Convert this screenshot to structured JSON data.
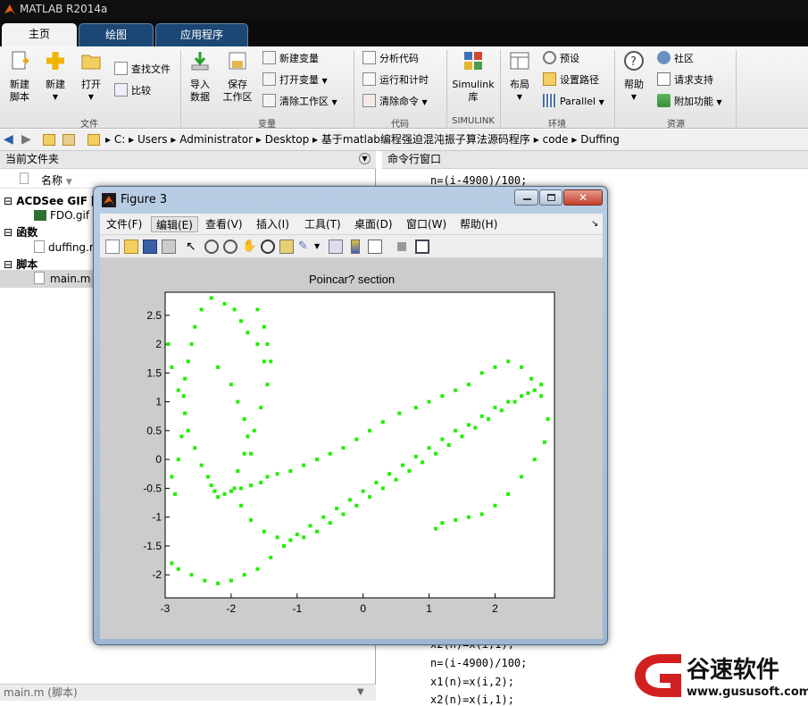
{
  "window": {
    "title": "MATLAB R2014a"
  },
  "ribbon_tabs": [
    "主页",
    "绘图",
    "应用程序"
  ],
  "ribbon": {
    "file_group": {
      "label": "文件",
      "new_script": "新建\n脚本",
      "new": "新建",
      "open": "打开",
      "find_files": "查找文件",
      "compare": "比较"
    },
    "variable_group": {
      "label": "变量",
      "import_data": "导入\n数据",
      "save_workspace": "保存\n工作区",
      "new_variable": "新建变量",
      "open_variable": "打开变量",
      "clear_workspace": "清除工作区"
    },
    "code_group": {
      "label": "代码",
      "analyze_code": "分析代码",
      "run_and_time": "运行和计时",
      "clear_commands": "清除命令"
    },
    "simulink_group": {
      "label": "SIMULINK",
      "simulink": "Simulink\n库"
    },
    "environment_group": {
      "label": "环境",
      "layout": "布局",
      "preferences": "预设",
      "set_path": "设置路径",
      "parallel": "Parallel"
    },
    "resources_group": {
      "label": "资源",
      "help": "帮助",
      "community": "社区",
      "request_support": "请求支持",
      "add_ons": "附加功能"
    }
  },
  "address_path": [
    "C:",
    "Users",
    "Administrator",
    "Desktop",
    "基于matlab编程强迫混沌振子算法源码程序",
    "code",
    "Duffing"
  ],
  "current_folder": {
    "title": "当前文件夹",
    "column_name": "名称",
    "sections": [
      {
        "name": "ACDSee GIF 图",
        "files": [
          "FDO.gif"
        ]
      },
      {
        "name": "函数",
        "files": [
          "duffing.m"
        ]
      },
      {
        "name": "脚本",
        "files": [
          "main.m"
        ]
      }
    ],
    "status": "main.m (脚本)"
  },
  "command_window": {
    "title": "命令行窗口",
    "lines_top": [
      "n=(i-4900)/100;"
    ],
    "lines_bottom": [
      "x2(n)=x(i,1);",
      "n=(i-4900)/100;",
      "x1(n)=x(i,2);",
      "x2(n)=x(i,1);"
    ]
  },
  "figure": {
    "title": "Figure 3",
    "menus": [
      "文件(F)",
      "编辑(E)",
      "查看(V)",
      "插入(I)",
      "工具(T)",
      "桌面(D)",
      "窗口(W)",
      "帮助(H)"
    ],
    "menu_overflow": "↘"
  },
  "chart_data": {
    "type": "scatter",
    "title": "Poincar? section",
    "xlabel": "",
    "ylabel": "",
    "xlim": [
      -3,
      2.9
    ],
    "ylim": [
      -2.4,
      2.9
    ],
    "xticks": [
      "-3",
      "-2",
      "-1",
      "0",
      "1",
      "2"
    ],
    "yticks": [
      "-2",
      "-1.5",
      "-1",
      "-0.5",
      "0",
      "0.5",
      "1",
      "1.5",
      "2",
      "2.5"
    ],
    "marker_color": "#22ee00",
    "series": [
      {
        "values_x": [
          -2.1,
          -1.95,
          -1.85,
          -1.75,
          -1.6,
          -1.5,
          -2.3,
          -2.45,
          -2.55,
          -2.6,
          -2.65,
          -2.7,
          -2.72,
          -2.7,
          -2.65,
          -2.55,
          -2.45,
          -2.35,
          -2.3,
          -2.25,
          -2.2,
          -2.1,
          -2.0,
          -1.85,
          -1.7,
          -1.55,
          -1.45,
          -1.3,
          -1.1,
          -0.9,
          -0.7,
          -0.5,
          -0.3,
          -0.1,
          0.1,
          0.3,
          0.55,
          0.8,
          1.0,
          1.2,
          1.4,
          1.6,
          1.8,
          2.0,
          2.2,
          2.4,
          2.55,
          2.7,
          2.8,
          2.75,
          2.6,
          2.4,
          2.2,
          2.0,
          1.8,
          1.6,
          1.4,
          1.2,
          1.1,
          -2.9,
          -2.8,
          -2.6,
          -2.4,
          -2.2,
          -2.0,
          -1.8,
          -1.6,
          -1.4,
          -1.2,
          -1.0,
          -0.8,
          -0.6,
          -0.4,
          -0.2,
          0.0,
          0.2,
          0.4,
          0.6,
          0.8,
          1.0,
          1.2,
          1.4,
          1.6,
          1.8,
          2.0,
          2.2,
          2.4,
          2.6,
          -2.95,
          -2.9,
          -2.8,
          -2.7,
          -2.75,
          -2.8,
          -2.9,
          -2.85,
          -2.2,
          -2.0,
          -1.9,
          -1.8,
          -1.75,
          -1.8,
          -1.9,
          -1.95,
          -1.85,
          -1.7,
          -1.5,
          -1.3,
          -1.1,
          -0.9,
          -0.7,
          -0.5,
          -0.3,
          -0.1,
          0.1,
          0.3,
          0.5,
          0.7,
          0.9,
          1.1,
          1.3,
          1.5,
          1.7,
          1.9,
          2.1,
          2.3,
          2.5,
          2.7,
          -1.6,
          -1.5,
          -1.45,
          -1.4,
          -1.45,
          -1.55,
          -1.65,
          -1.7
        ],
        "values_y": [
          2.7,
          2.6,
          2.4,
          2.2,
          2.0,
          1.7,
          2.8,
          2.6,
          2.3,
          2.0,
          1.7,
          1.4,
          1.1,
          0.8,
          0.5,
          0.2,
          -0.1,
          -0.3,
          -0.45,
          -0.55,
          -0.65,
          -0.6,
          -0.55,
          -0.5,
          -0.45,
          -0.4,
          -0.3,
          -0.25,
          -0.2,
          -0.1,
          0.0,
          0.1,
          0.2,
          0.35,
          0.5,
          0.65,
          0.8,
          0.9,
          1.0,
          1.1,
          1.2,
          1.3,
          1.5,
          1.6,
          1.7,
          1.6,
          1.4,
          1.1,
          0.7,
          0.3,
          0.0,
          -0.3,
          -0.6,
          -0.8,
          -0.95,
          -1.0,
          -1.05,
          -1.1,
          -1.2,
          -1.8,
          -1.9,
          -2.0,
          -2.1,
          -2.15,
          -2.1,
          -2.0,
          -1.9,
          -1.7,
          -1.5,
          -1.3,
          -1.15,
          -1.0,
          -0.85,
          -0.7,
          -0.55,
          -0.4,
          -0.25,
          -0.1,
          0.05,
          0.2,
          0.35,
          0.5,
          0.6,
          0.75,
          0.9,
          1.0,
          1.1,
          1.2,
          2.0,
          1.6,
          1.2,
          0.8,
          0.4,
          0.0,
          -0.3,
          -0.6,
          1.6,
          1.3,
          1.0,
          0.7,
          0.4,
          0.1,
          -0.2,
          -0.5,
          -0.8,
          -1.05,
          -1.25,
          -1.35,
          -1.4,
          -1.35,
          -1.25,
          -1.1,
          -0.95,
          -0.8,
          -0.65,
          -0.5,
          -0.35,
          -0.2,
          -0.05,
          0.1,
          0.25,
          0.4,
          0.55,
          0.7,
          0.85,
          1.0,
          1.15,
          1.3,
          2.6,
          2.3,
          2.0,
          1.7,
          1.3,
          0.9,
          0.5,
          0.1
        ]
      }
    ]
  }
}
